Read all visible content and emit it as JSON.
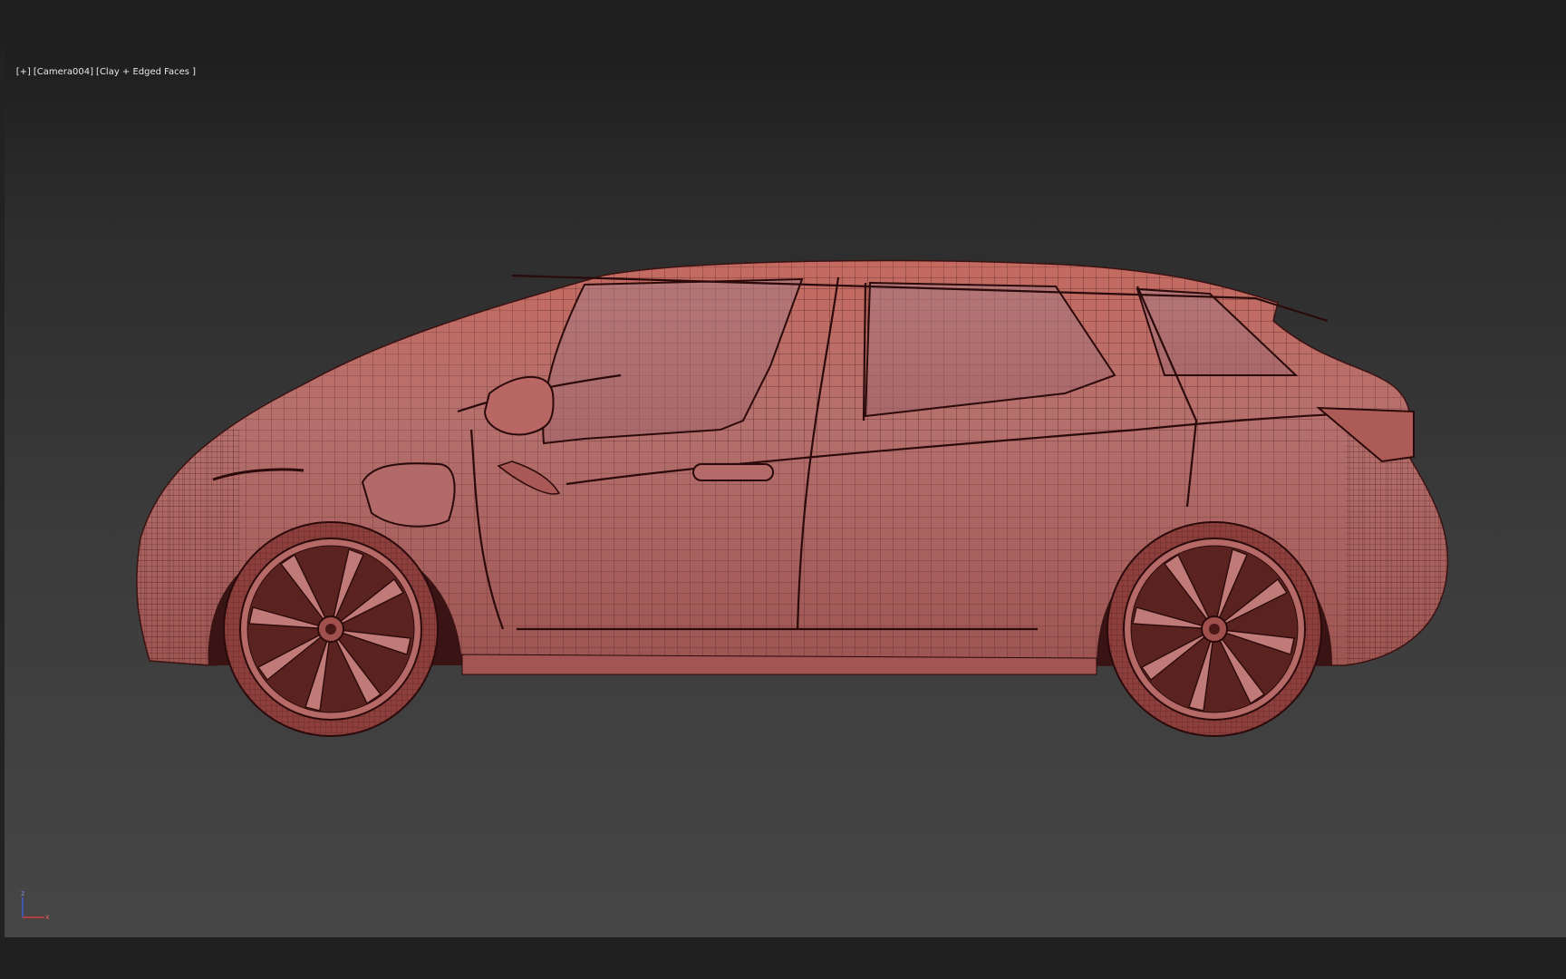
{
  "viewport": {
    "menu_label": "[+]",
    "camera_label": "[Camera004]",
    "shading_label": "[Clay + Edged Faces ]"
  },
  "scene": {
    "object": "car-wireframe-model",
    "body_color": "#b86360",
    "edge_color": "#3a1212"
  },
  "gizmo": {
    "z_label": "z",
    "x_label": "x"
  }
}
